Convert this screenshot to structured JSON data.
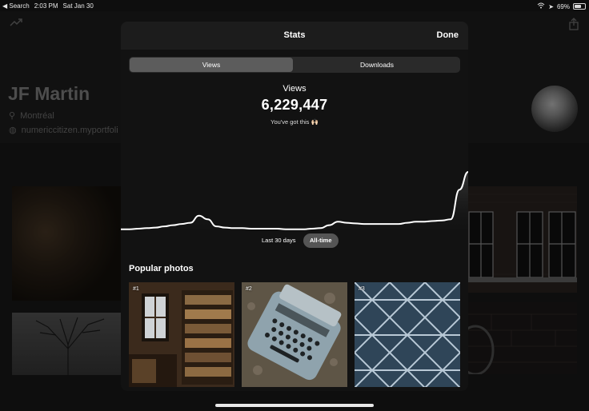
{
  "status_bar": {
    "back_label": "◀ Search",
    "time": "2:03 PM",
    "date": "Sat Jan 30",
    "battery": "69%"
  },
  "profile": {
    "name": "JF Martin",
    "location": "Montréal",
    "website": "numericcitizen.myportfoli"
  },
  "sheet": {
    "title": "Stats",
    "done_label": "Done",
    "tabs": [
      {
        "label": "Views",
        "active": true
      },
      {
        "label": "Downloads",
        "active": false
      }
    ],
    "stat_label": "Views",
    "stat_value": "6,229,447",
    "stat_note": "You've got this 🙌🏻",
    "ranges": [
      {
        "label": "Last 30 days",
        "active": false
      },
      {
        "label": "All-time",
        "active": true
      }
    ],
    "popular_title": "Popular photos",
    "popular": [
      {
        "rank": "#1"
      },
      {
        "rank": "#2"
      },
      {
        "rank": "#3"
      }
    ]
  },
  "chart_data": {
    "type": "area",
    "x": [
      0,
      1,
      2,
      3,
      4,
      5,
      6,
      7,
      8,
      9,
      10,
      11,
      12,
      13,
      14,
      15,
      16,
      17,
      18,
      19,
      20,
      21,
      22,
      23,
      24,
      25,
      26,
      27,
      28,
      29,
      30,
      31,
      32,
      33,
      34,
      35,
      36,
      37,
      38,
      39,
      40
    ],
    "values": [
      3,
      3,
      4,
      5,
      6,
      8,
      10,
      12,
      14,
      26,
      20,
      8,
      6,
      5,
      5,
      4,
      4,
      4,
      4,
      3,
      3,
      3,
      4,
      5,
      10,
      16,
      14,
      13,
      12,
      12,
      12,
      12,
      12,
      14,
      16,
      16,
      17,
      18,
      20,
      70,
      100
    ],
    "title": "",
    "xlabel": "",
    "ylabel": "",
    "ylim": [
      0,
      100
    ],
    "grid": false
  },
  "colors": {
    "accent": "#ffffff",
    "sheet_bg": "#121212"
  }
}
